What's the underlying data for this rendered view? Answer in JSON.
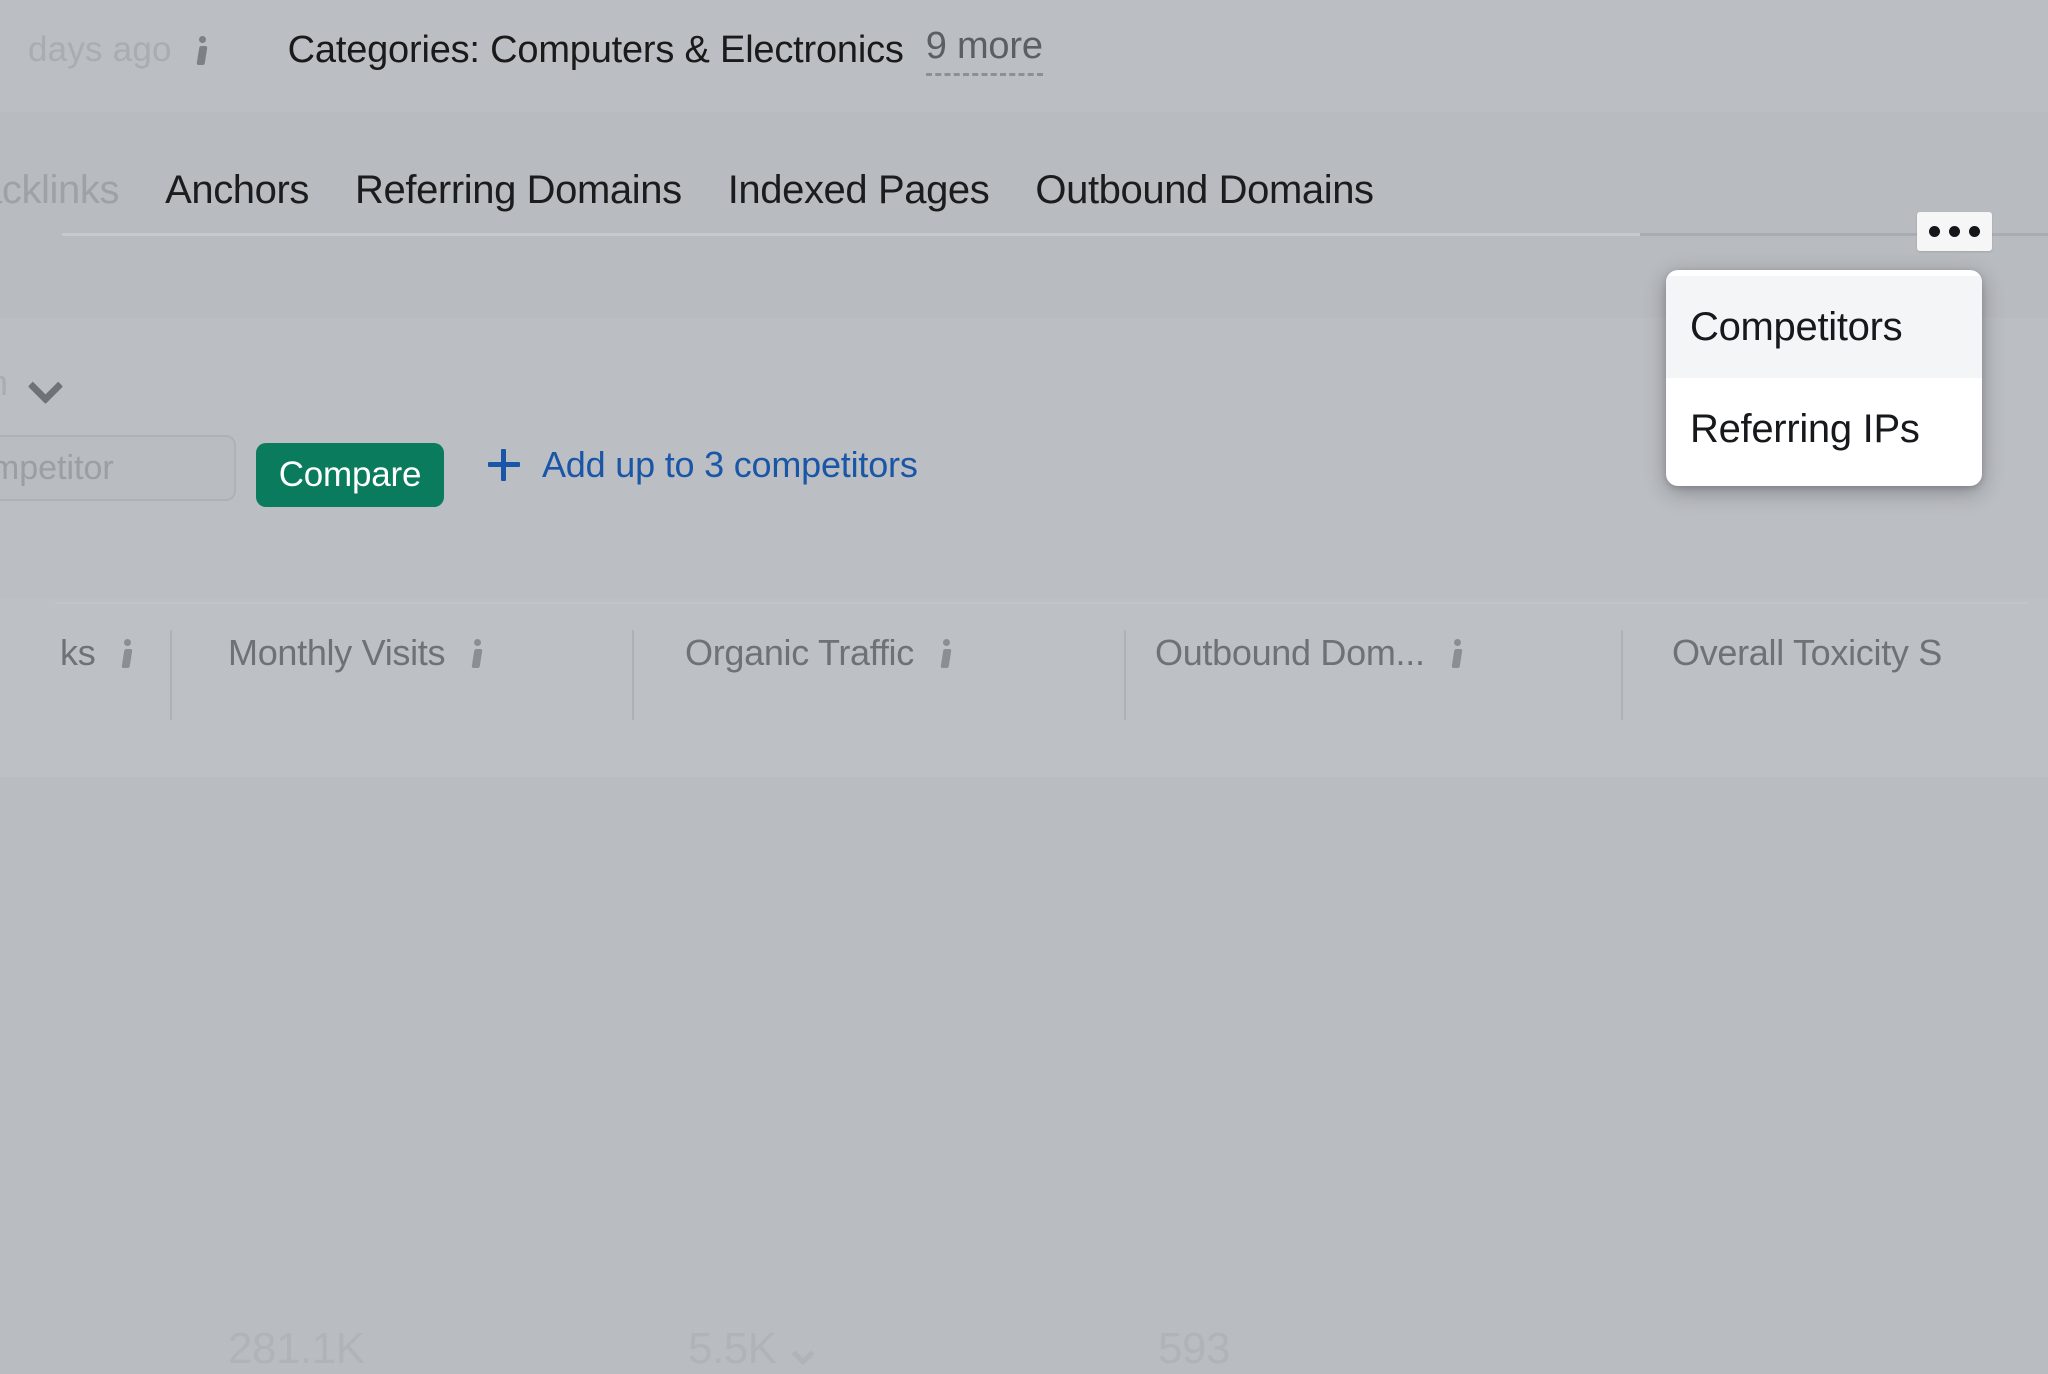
{
  "header": {
    "updated_text": "days ago",
    "updated_info_icon": "info-icon",
    "categories_label": "Categories: Computers & Electronics",
    "more_link": "9 more"
  },
  "tabs": {
    "items": [
      {
        "label": "acklinks",
        "active": false,
        "truncated": true
      },
      {
        "label": "Anchors",
        "active": false
      },
      {
        "label": "Referring Domains",
        "active": false
      },
      {
        "label": "Indexed Pages",
        "active": false
      },
      {
        "label": "Outbound Domains",
        "active": false
      }
    ],
    "overflow_icon": "ellipsis-icon"
  },
  "dropdown": {
    "items": [
      {
        "label": "Competitors",
        "hovered": true
      },
      {
        "label": "Referring IPs",
        "hovered": false
      }
    ]
  },
  "compare": {
    "mode_label": "ain",
    "mode_caret_icon": "chevron-down-icon",
    "competitor_input_value": "ompetitor",
    "competitor_input_placeholder": "Enter competitor",
    "compare_button_label": "Compare",
    "add_icon": "plus-icon",
    "add_link_label": "Add up to 3 competitors"
  },
  "table": {
    "columns": [
      {
        "label": "ks",
        "info_icon": "info-icon"
      },
      {
        "label": "Monthly Visits",
        "info_icon": "info-icon"
      },
      {
        "label": "Organic Traffic",
        "info_icon": "info-icon"
      },
      {
        "label": "Outbound Dom...",
        "info_icon": "info-icon"
      },
      {
        "label": "Overall Toxicity S",
        "info_icon": null
      }
    ],
    "row_values": {
      "monthly_visits": "281.1K",
      "organic_traffic": "5.5K",
      "outbound_domains": "593"
    }
  },
  "colors": {
    "page_background": "#babdc1",
    "accent_green": "#0a7b5c",
    "link_blue": "#1a56a8",
    "menu_background": "#ffffff",
    "menu_hover": "#f4f5f6",
    "text_primary": "#1b1c1e",
    "text_muted": "#9ea2a7"
  }
}
